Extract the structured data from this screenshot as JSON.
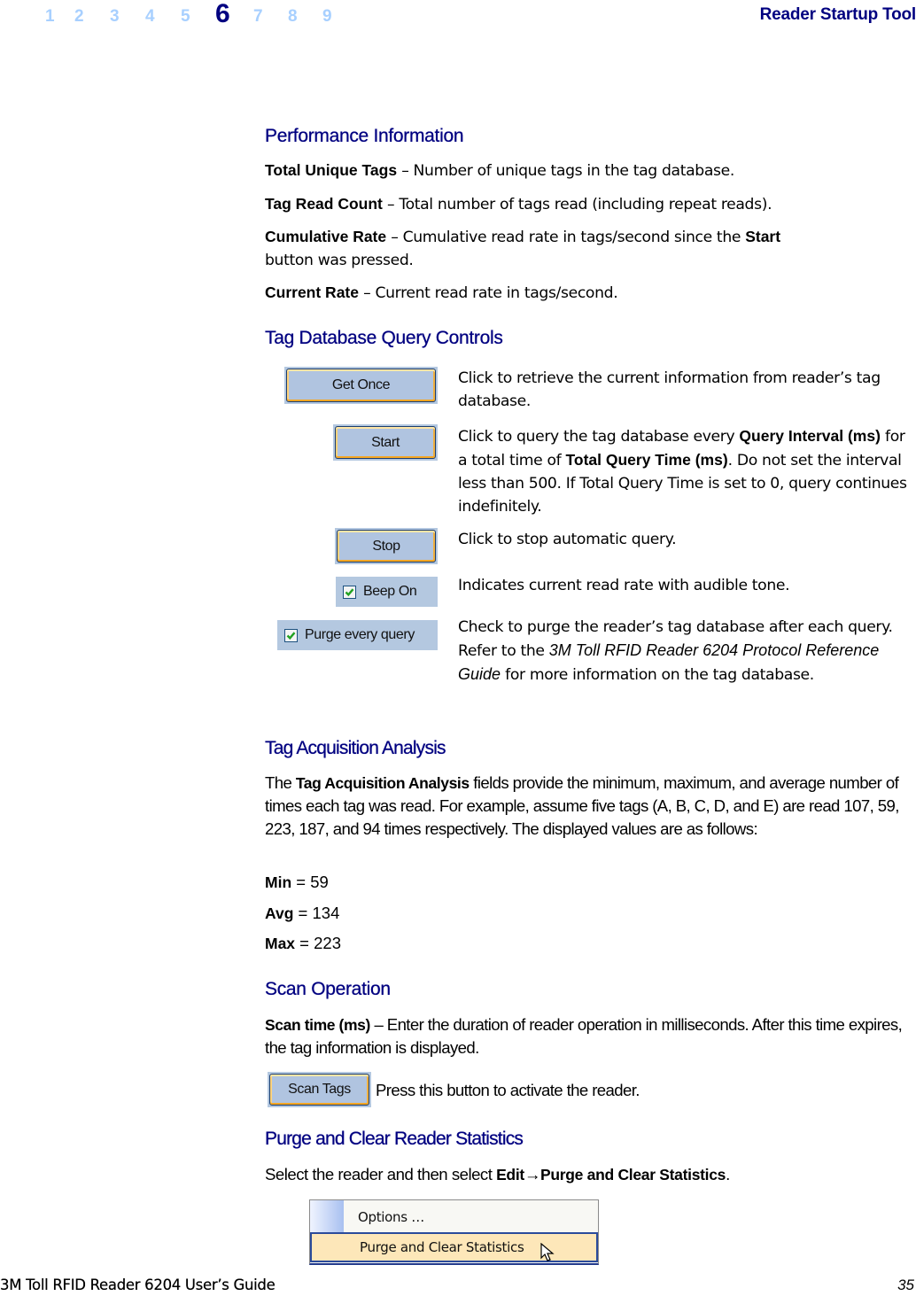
{
  "header": {
    "chapters": [
      "1",
      "2",
      "3",
      "4",
      "5",
      "6",
      "7",
      "8",
      "9"
    ],
    "active_chapter": "6",
    "running_title": "Reader Startup Tool"
  },
  "colors": {
    "heading": "#000080",
    "chapter_inactive": "#a8d0ff",
    "button_face": "#b0c4e0",
    "button_hover_border": "#f5a623",
    "menu_highlight": "#fde7b9"
  },
  "performance": {
    "heading": "Performance Information",
    "items": [
      {
        "term": "Total Unique Tags",
        "text": " – Number of unique tags in the tag database."
      },
      {
        "term": "Tag Read Count",
        "text": " – Total number of tags read (including repeat reads)."
      },
      {
        "term": "Cumulative Rate",
        "text": " – Cumulative read rate in tags/second since the ",
        "term2": "Start",
        "text2": "button was pressed."
      },
      {
        "term": "Current Rate",
        "text": " – Current read rate in tags/second."
      }
    ]
  },
  "query_controls": {
    "heading": "Tag Database Query Controls",
    "get_once": {
      "label": "Get Once",
      "desc": "Click to retrieve the current information from reader’s tag database."
    },
    "start": {
      "label": "Start",
      "desc_1": "Click to query the tag database every ",
      "bold_1": "Query Interval (ms)",
      "desc_2": " for a total time of ",
      "bold_2": "Total Query Time (ms)",
      "desc_3": ". Do not set the interval less than 500. If Total Query Time is set to 0, query continues indefinitely."
    },
    "stop": {
      "label": "Stop",
      "desc": "Click to stop automatic query."
    },
    "beep_on": {
      "label": "Beep On",
      "checked": true,
      "desc": "Indicates current read rate with audible tone."
    },
    "purge_every_query": {
      "label": "Purge every query",
      "checked": true,
      "desc_1": "Check to purge the reader’s tag database after each query. Refer to the ",
      "italic": "3M Toll RFID Reader 6204 Protocol Reference Guide",
      "desc_2": " for more information on the tag database."
    }
  },
  "acquisition": {
    "heading": "Tag Acquisition Analysis",
    "intro_1": "The ",
    "intro_bold": "Tag Acquisition Analysis",
    "intro_2": " fields provide the minimum, maximum, and average number of times each tag was read. For example, assume five tags (A, B, C, D, and E) are read 107, 59, 223, 187, and 94 times respectively. The displayed values are as follows:",
    "stats": [
      {
        "label": "Min",
        "value": " = 59"
      },
      {
        "label": "Avg",
        "value": " = 134"
      },
      {
        "label": "Max",
        "value": " = 223"
      }
    ]
  },
  "scan": {
    "heading": "Scan Operation",
    "term": "Scan time (ms)",
    "text": " – Enter the duration of reader operation in milliseconds. After this time expires, the tag information is displayed.",
    "button_label": "Scan Tags",
    "button_desc": "Press this button to activate the reader."
  },
  "purge_clear": {
    "heading": "Purge and Clear Reader Statistics",
    "text_1": "Select the reader and then select ",
    "bold_1": "Edit",
    "arrow": "→",
    "bold_2": "Purge and Clear Statistics",
    "text_2": ".",
    "menu_items": [
      "Options …",
      "Purge and Clear Statistics"
    ]
  },
  "footer": {
    "guide_title": "3M Toll RFID Reader 6204 User’s Guide",
    "page_number": "35"
  }
}
